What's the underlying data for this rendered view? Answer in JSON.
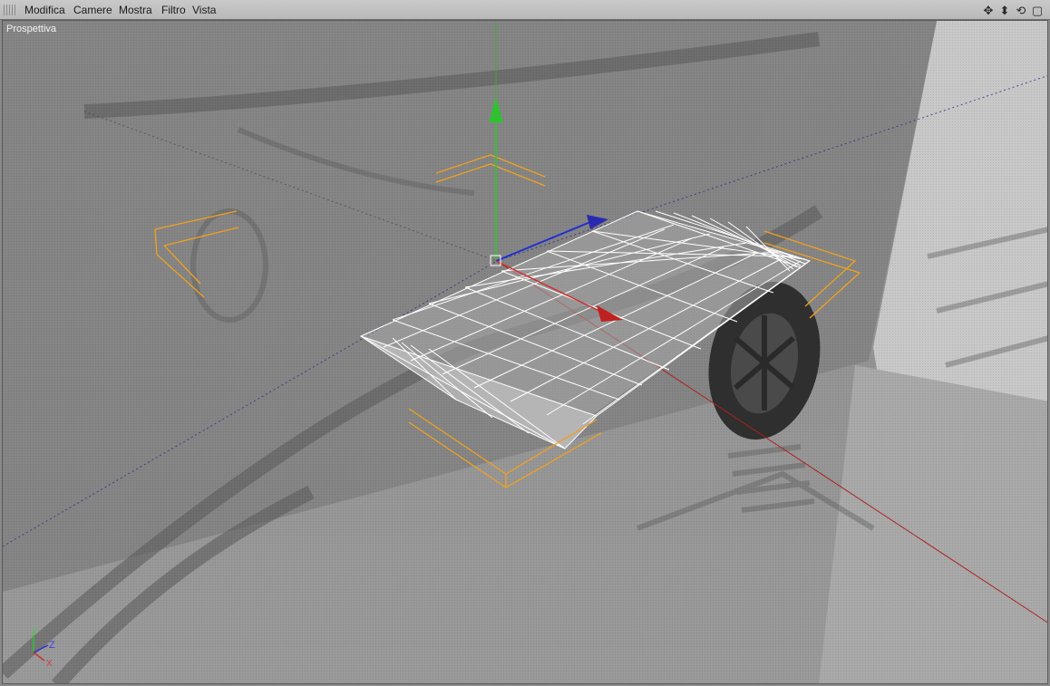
{
  "menu": {
    "items": [
      "Modifica",
      "Camere",
      "Mostra",
      "Filtro",
      "Vista"
    ]
  },
  "nav_icons": [
    "move-view-icon",
    "dolly-view-icon",
    "rotate-view-icon",
    "maximize-view-icon"
  ],
  "viewport": {
    "label": "Prospettiva",
    "axis_labels": {
      "y": "Y",
      "z": "Z",
      "x": "X"
    }
  },
  "colors": {
    "axis_x": "#d02020",
    "axis_y": "#20c020",
    "axis_z": "#2020c0",
    "selection_bracket": "#f0a020",
    "wireframe": "#ffffff",
    "menubar": "#c2c2c2"
  }
}
